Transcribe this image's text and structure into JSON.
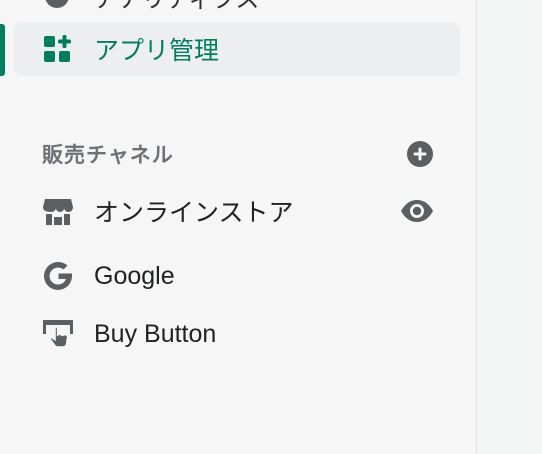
{
  "nav": {
    "cut_item_label": "アナリティクス",
    "active_item": {
      "label": "アプリ管理",
      "icon": "apps-icon"
    }
  },
  "sales_channels": {
    "title": "販売チャネル",
    "add_icon": "plus-circle-icon",
    "items": [
      {
        "label": "オンラインストア",
        "icon": "store-icon",
        "trailing_icon": "eye-icon"
      },
      {
        "label": "Google",
        "icon": "google-icon"
      },
      {
        "label": "Buy Button",
        "icon": "buy-button-icon"
      }
    ]
  },
  "colors": {
    "accent": "#008060",
    "icon": "#5c5f62",
    "text": "#202223",
    "muted": "#6d7175",
    "background": "#f6f6f7"
  }
}
